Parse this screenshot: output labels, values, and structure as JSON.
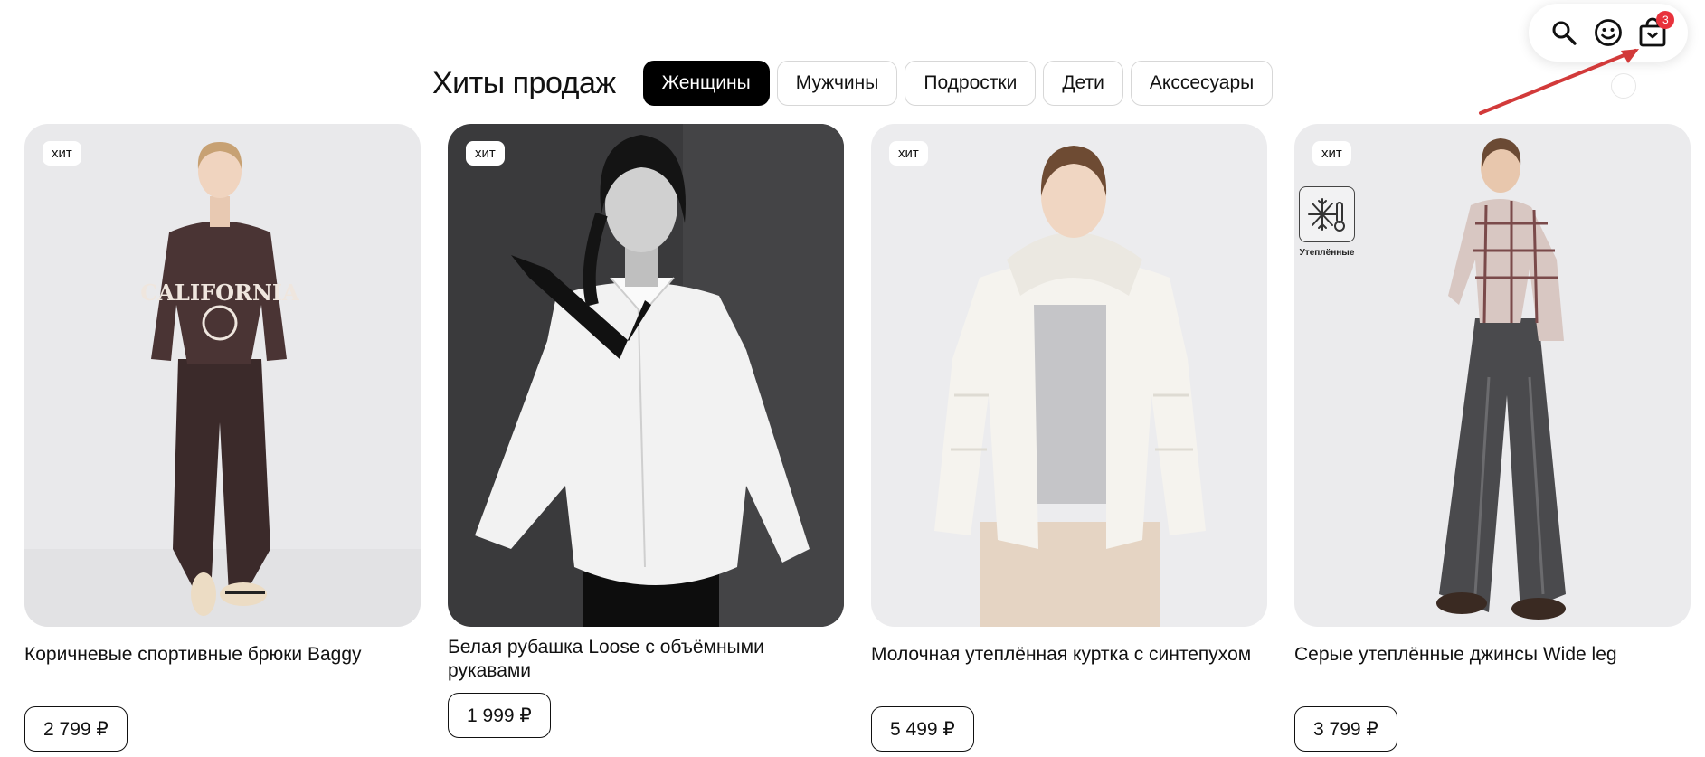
{
  "header": {
    "icons": [
      "search-icon",
      "smiley-account-icon",
      "shopping-bag-icon"
    ],
    "cart_count": "3"
  },
  "section": {
    "title": "Хиты продаж",
    "tabs": [
      {
        "label": "Женщины",
        "active": true
      },
      {
        "label": "Мужчины",
        "active": false
      },
      {
        "label": "Подростки",
        "active": false
      },
      {
        "label": "Дети",
        "active": false
      },
      {
        "label": "Акссесуары",
        "active": false
      }
    ]
  },
  "products": [
    {
      "badge": "хит",
      "name": "Коричневые спортивные брюки Baggy",
      "price": "2 799 ₽"
    },
    {
      "badge": "хит",
      "name": "Белая рубашка Loose с объёмными рукавами",
      "price": "1 999 ₽"
    },
    {
      "badge": "хит",
      "name": "Молочная утеплённая куртка с синтепухом",
      "price": "5 499 ₽"
    },
    {
      "badge": "хит",
      "name": "Серые утеплённые джинсы Wide leg",
      "price": "3 799 ₽",
      "feature_label": "Утеплённые",
      "feature_icon": "snowflake-thermometer-icon"
    }
  ],
  "colors": {
    "accent": "#000000",
    "badge_red": "#e8323c",
    "annotation_arrow": "#d23a3a"
  }
}
